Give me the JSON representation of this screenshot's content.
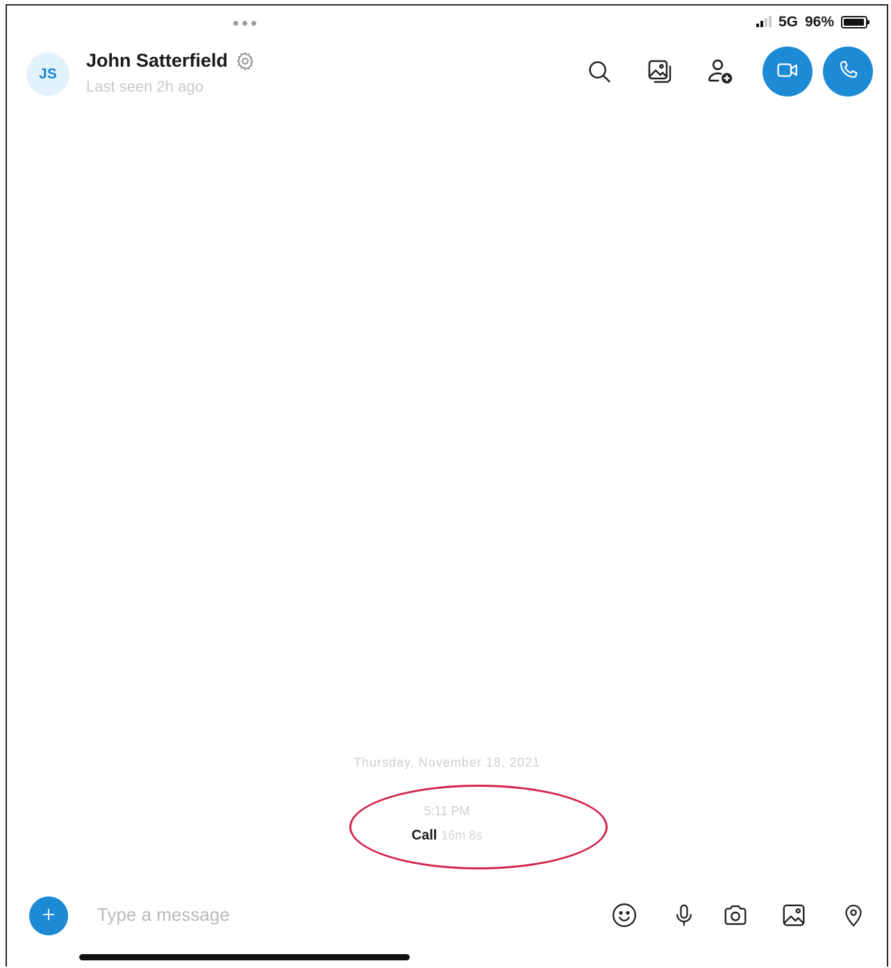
{
  "status_bar": {
    "network": "5G",
    "battery": "96%",
    "battery_level": 0.96
  },
  "header": {
    "avatar_initials": "JS",
    "contact_name": "John Satterfield",
    "last_seen": "Last seen 2h ago",
    "icons": {
      "settings": "gear-icon",
      "search": "search-icon",
      "gallery": "gallery-icon",
      "add_person": "add-person-icon",
      "video_call": "video-camera-icon",
      "audio_call": "phone-icon"
    }
  },
  "conversation": {
    "date_separator": "Thursday, November 18, 2021",
    "call_event": {
      "time": "5:11 PM",
      "label": "Call",
      "duration": "16m 8s"
    }
  },
  "composer": {
    "placeholder": "Type a message",
    "icons": [
      "plus-icon",
      "emoji-icon",
      "microphone-icon",
      "camera-icon",
      "image-icon",
      "location-icon"
    ]
  },
  "colors": {
    "accent": "#1d8ad6",
    "highlight_ellipse": "#d3244f",
    "avatar_bg": "#e2f2fb"
  }
}
